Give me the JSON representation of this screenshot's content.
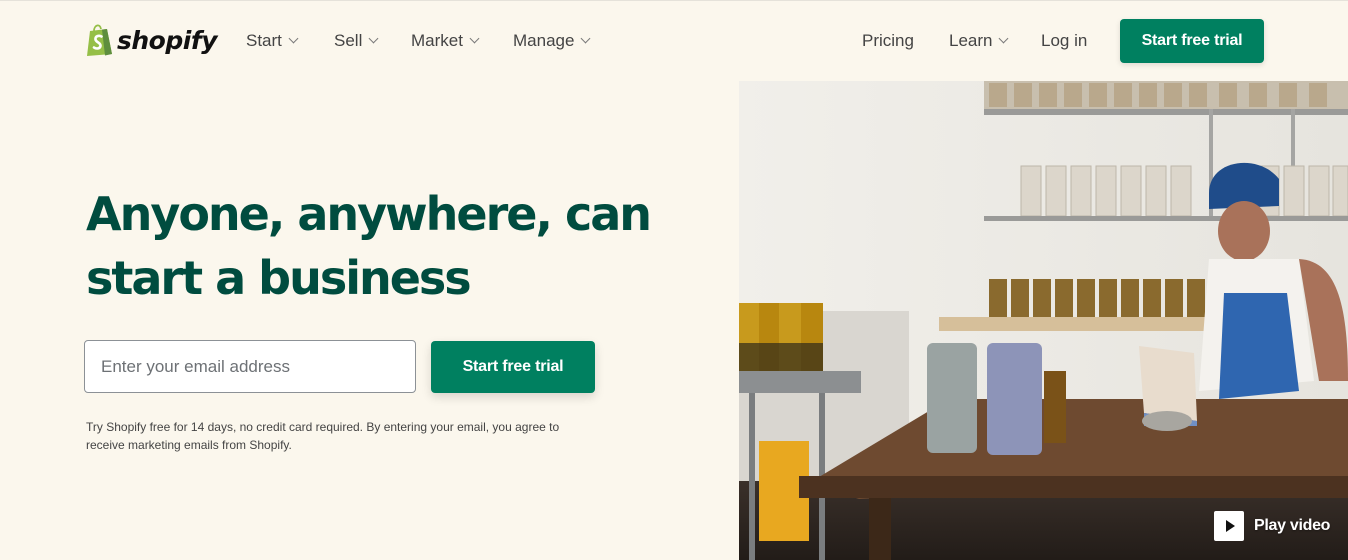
{
  "brand": {
    "name": "shopify",
    "logo_icon": "shopping-bag-icon",
    "accent_color": "#008060",
    "logo_color": "#95bf47",
    "heading_color": "#004c3f",
    "background_color": "#fbf7ed"
  },
  "nav": {
    "left_items": [
      {
        "label": "Start",
        "has_dropdown": true
      },
      {
        "label": "Sell",
        "has_dropdown": true
      },
      {
        "label": "Market",
        "has_dropdown": true
      },
      {
        "label": "Manage",
        "has_dropdown": true
      }
    ],
    "right_items": [
      {
        "label": "Pricing",
        "has_dropdown": false
      },
      {
        "label": "Learn",
        "has_dropdown": true
      },
      {
        "label": "Log in",
        "has_dropdown": false
      }
    ],
    "cta_label": "Start free trial"
  },
  "hero": {
    "title_line1": "Anyone, anywhere, can",
    "title_line2": "start a business",
    "email_placeholder": "Enter your email address",
    "email_value": "",
    "cta_label": "Start free trial",
    "disclaimer_line1": "Try Shopify free for 14 days, no credit card required. By entering your email, you agree to",
    "disclaimer_line2": "receive marketing emails from Shopify.",
    "image_description": "Woman in blue headscarf and apron working on a tablet at a wooden table surrounded by jars of herbs",
    "play_video_label": "Play video",
    "play_icon": "play-icon"
  }
}
